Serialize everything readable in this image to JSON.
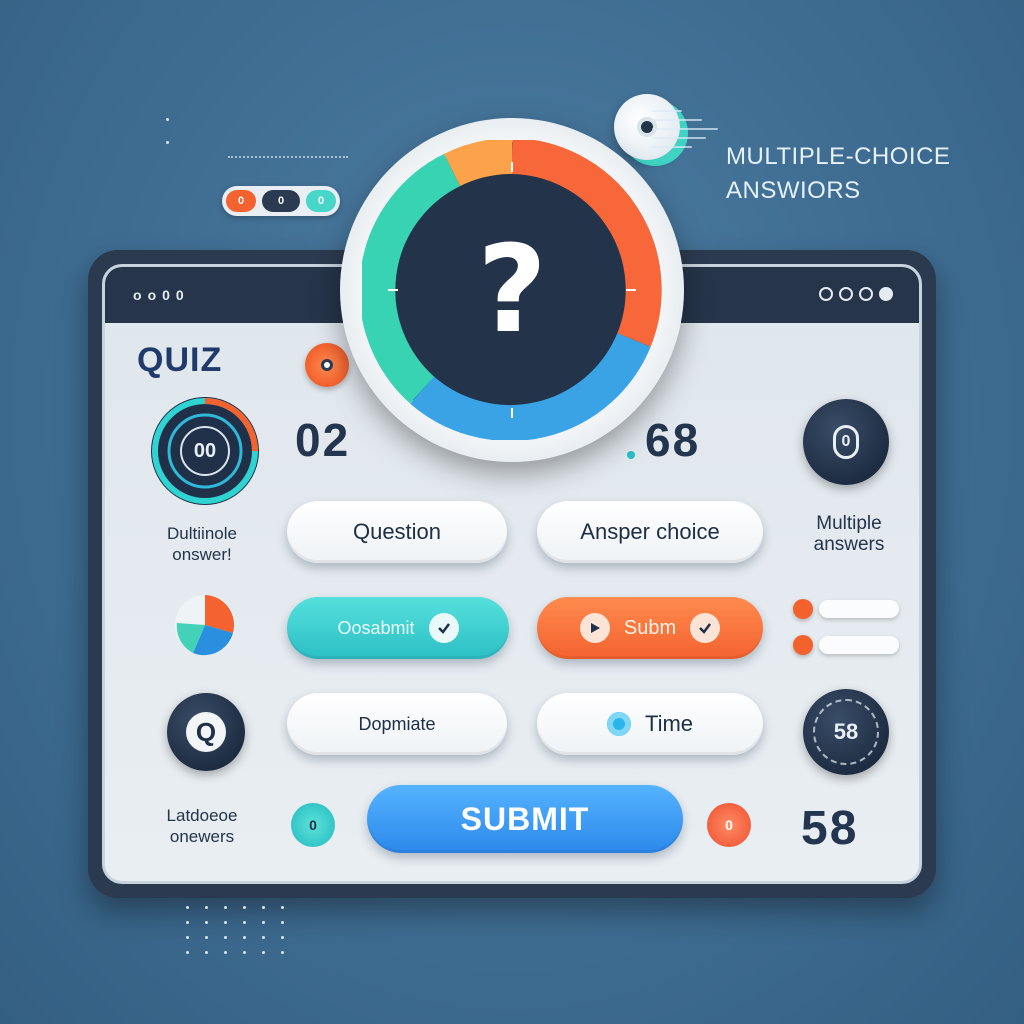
{
  "header": {
    "title_line1": "MULTIPLE-CHOICE",
    "title_line2": "ANSWIORS"
  },
  "top_toggle": {
    "seg1": "0",
    "seg2": "0",
    "seg3": "0"
  },
  "window": {
    "titlebar_left": [
      "o",
      "o",
      "0",
      "0"
    ],
    "quiz_label": "QUIZ"
  },
  "gauge": {
    "symbol": "?"
  },
  "left_column": {
    "ring_label": "00",
    "text1_line1": "Dultiinole",
    "text1_line2": "onswer!",
    "q_circle": "Q",
    "text2_line1": "Latdoeoe",
    "text2_line2": "onewers"
  },
  "numbers": {
    "left": "02",
    "right": "68"
  },
  "right_column": {
    "circle1": "0",
    "text1_line1": "Multiple",
    "text1_line2": "answers",
    "circle2": "58",
    "number": "58"
  },
  "buttons": {
    "question": "Question",
    "answer_choice": "Ansper choice",
    "teal_submit": "Oosabmit",
    "orange_submit": "Subm",
    "dopmate": "Dopmiate",
    "time": "Time",
    "submit": "SUBMIT"
  },
  "badges": {
    "left_teal": "0",
    "right_orange": "0"
  },
  "colors": {
    "background": "#3f6d92",
    "teal": "#2bbfc5",
    "orange": "#f4622f",
    "blue": "#2c88ea",
    "navy": "#1c2b40"
  }
}
